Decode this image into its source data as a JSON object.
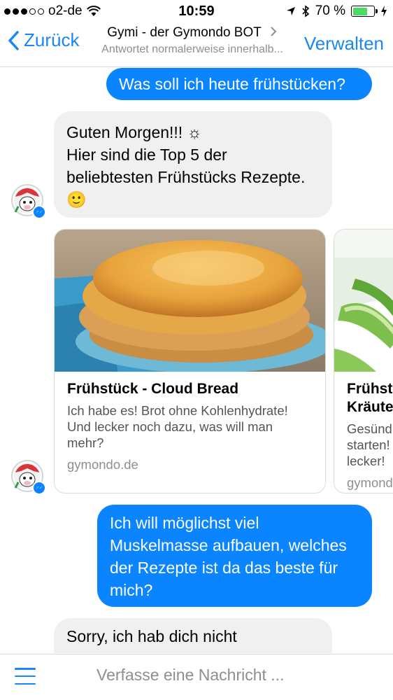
{
  "status_bar": {
    "carrier": "o2-de",
    "time": "10:59",
    "battery_percent": "70 %",
    "battery_level": 0.7,
    "battery_color": "#4cd964"
  },
  "nav": {
    "back_label": "Zurück",
    "title": "Gymi - der Gymondo BOT",
    "subtitle": "Antwortet normalerweise innerhalb...",
    "manage_label": "Verwalten"
  },
  "messages": {
    "m1": "Was soll ich heute frühstücken?",
    "m2_line1": "Guten Morgen!!! ☼",
    "m2_line2": "Hier sind die Top 5 der",
    "m2_line3": "beliebtesten Frühstücks Rezepte.",
    "m2_emoji": "🙂",
    "m3_line1": "Ich will möglichst viel",
    "m3_line2": "Muskelmasse aufbauen, welches",
    "m3_line3": "der Rezepte ist da das beste für",
    "m3_line4": "mich?",
    "m4_line1": "Sorry, ich hab dich nicht"
  },
  "cards": [
    {
      "title": "Frühstück  - Cloud Bread",
      "desc_line1": "Ich habe es! Brot ohne Kohlenhydrate!",
      "desc_line2": "Und lecker noch dazu, was will man",
      "desc_line3": "mehr?",
      "domain": "gymondo.de"
    },
    {
      "title_line1": "Frühstü",
      "title_line2": "Kräute",
      "desc_line1": "Gesünd",
      "desc_line2": "starten!",
      "desc_line3": "lecker!",
      "domain": "gymond"
    }
  ],
  "composer": {
    "placeholder": "Verfasse eine Nachricht ..."
  },
  "colors": {
    "accent": "#1b86f5",
    "outgoing_bubble": "#0a84ff",
    "incoming_bubble": "#f0f0f0"
  },
  "icons": [
    "wifi-icon",
    "location-arrow-icon",
    "bluetooth-icon",
    "charging-icon",
    "back-chevron-icon",
    "chevron-right-icon",
    "messenger-badge-icon",
    "menu-icon"
  ]
}
